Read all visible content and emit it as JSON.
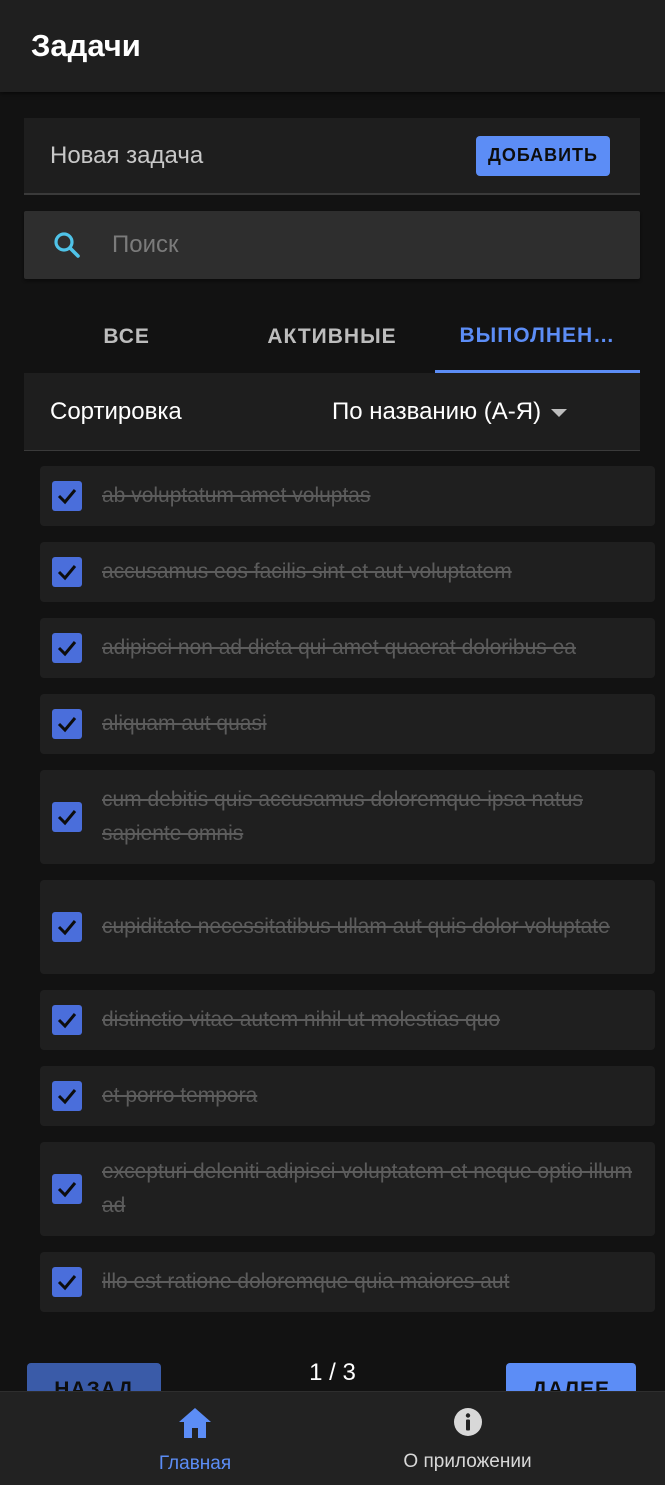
{
  "appbar": {
    "title": "Задачи"
  },
  "new_task": {
    "placeholder": "Новая задача",
    "add_label": "ДОБАВИТЬ"
  },
  "search": {
    "placeholder": "Поиск"
  },
  "tabs": [
    {
      "label": "ВСЕ",
      "active": false
    },
    {
      "label": "АКТИВНЫЕ",
      "active": false
    },
    {
      "label": "ВЫПОЛНЕН…",
      "active": true
    }
  ],
  "sort": {
    "label": "Сортировка",
    "value": "По названию (А-Я)"
  },
  "tasks": [
    {
      "text": "ab voluptatum amet voluptas",
      "done": true
    },
    {
      "text": "accusamus eos facilis sint et aut voluptatem",
      "done": true
    },
    {
      "text": "adipisci non ad dicta qui amet quaerat doloribus ea",
      "done": true
    },
    {
      "text": "aliquam aut quasi",
      "done": true
    },
    {
      "text": "cum debitis quis accusamus doloremque ipsa natus sapiente omnis",
      "done": true
    },
    {
      "text": "cupiditate necessitatibus ullam aut quis dolor voluptate",
      "done": true
    },
    {
      "text": "distinctio vitae autem nihil ut molestias quo",
      "done": true
    },
    {
      "text": "et porro tempora",
      "done": true
    },
    {
      "text": "excepturi deleniti adipisci voluptatem et neque optio illum ad",
      "done": true
    },
    {
      "text": "illo est ratione doloremque quia maiores aut",
      "done": true
    }
  ],
  "pagination": {
    "prev_label": "НАЗАД",
    "next_label": "ДАЛЕЕ",
    "page_text": "1 / 3"
  },
  "bottom_nav": [
    {
      "label": "Главная",
      "icon": "home-icon",
      "active": true
    },
    {
      "label": "О приложении",
      "icon": "info-icon",
      "active": false
    }
  ],
  "colors": {
    "accent": "#5c8df6",
    "checkbox": "#4a6edb",
    "background": "#121212"
  }
}
